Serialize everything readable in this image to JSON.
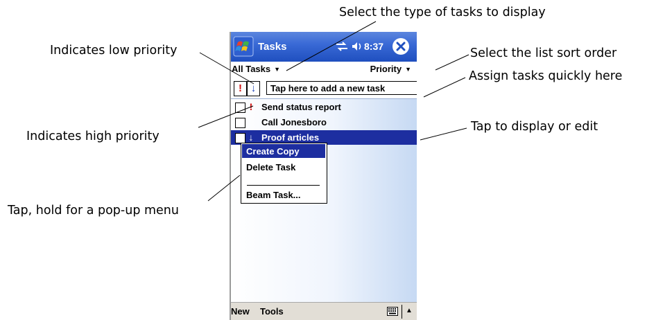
{
  "callouts": {
    "type_of_tasks": "Select the type of tasks to display",
    "low_priority": "Indicates low priority",
    "sort_order": "Select the list sort order",
    "assign_quickly": "Assign tasks quickly here",
    "high_priority": "Indicates high priority",
    "tap_display_edit": "Tap to display or edit",
    "tap_hold_popup": "Tap, hold for a pop-up menu"
  },
  "device": {
    "titlebar": {
      "app_title": "Tasks",
      "clock": "8:37"
    },
    "filterbar": {
      "category": "All Tasks",
      "sort": "Priority"
    },
    "entrybar": {
      "high_priority_glyph": "!",
      "low_priority_glyph": "↓",
      "new_task_placeholder": "Tap here to add a new task"
    },
    "tasks": [
      {
        "label": "Send status report",
        "priority": "high",
        "priority_glyph": "!",
        "selected": false
      },
      {
        "label": "Call Jonesboro",
        "priority": "normal",
        "priority_glyph": "",
        "selected": false
      },
      {
        "label": "Proof articles",
        "priority": "low",
        "priority_glyph": "↓",
        "selected": true
      }
    ],
    "popup_menu": {
      "items": [
        "Create Copy",
        "Delete Task",
        "Beam Task..."
      ]
    },
    "menubar": {
      "new_label": "New",
      "tools_label": "Tools"
    }
  },
  "colors": {
    "title_blue": "#1f4fbf",
    "selection_blue": "#1d2ea0",
    "high_priority_red": "#d01010",
    "low_priority_blue": "#1a3fb8",
    "menubar_gray": "#e2ded6"
  }
}
